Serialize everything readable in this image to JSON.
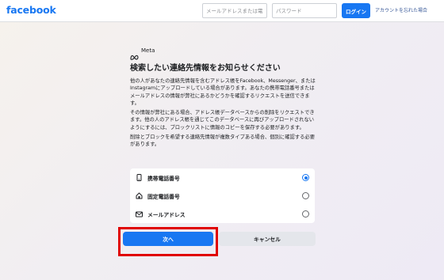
{
  "header": {
    "logo_text": "facebook",
    "email_placeholder": "メールアドレスまたは電",
    "password_placeholder": "パスワード",
    "login_label": "ログイン",
    "forgot_link": "アカウントを忘れた場合"
  },
  "brand": {
    "meta_label": "Meta",
    "accent_color": "#1877f2"
  },
  "content": {
    "title": "検索したい連絡先情報をお知らせください",
    "paragraphs": [
      "他の人があなたの連絡先情報を含むアドレス帳をFacebook、Messenger、またはInstagramにアップロードしている場合があります。あなたの携帯電話番号またはメールアドレスの情報が弊社にあるかどうかを確認するリクエストを送信できます。",
      "その情報が弊社にある場合、アドレス帳データベースからの削除をリクエストできます。他の人のアドレス帳を通じてこのデータベースに再びアップロードされないようにするには、ブロックリストに情報のコピーを保存する必要があります。",
      "削除とブロックを希望する連絡先情報が複数タイプある場合、個別に確認する必要があります。"
    ]
  },
  "options": [
    {
      "label": "携帯電話番号",
      "icon": "mobile-phone-icon",
      "selected": true
    },
    {
      "label": "固定電話番号",
      "icon": "home-phone-icon",
      "selected": false
    },
    {
      "label": "メールアドレス",
      "icon": "envelope-icon",
      "selected": false
    }
  ],
  "actions": {
    "next_label": "次へ",
    "cancel_label": "キャンセル"
  },
  "annotation": {
    "highlight_color": "#e00000"
  }
}
